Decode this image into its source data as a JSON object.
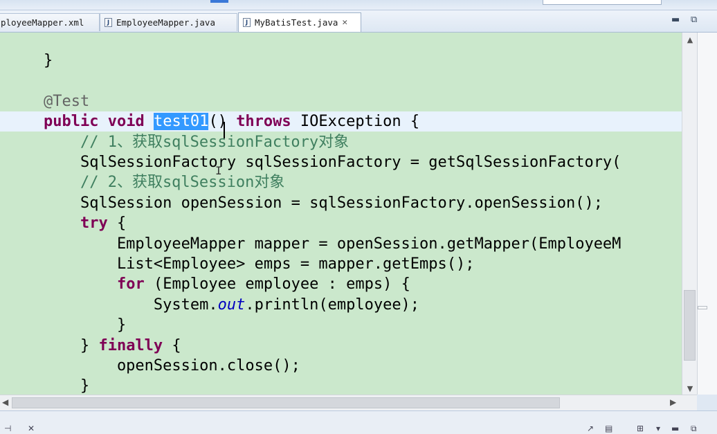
{
  "tabs": [
    {
      "label": "ployeeMapper.xml",
      "type": "xml",
      "active": false
    },
    {
      "label": "EmployeeMapper.java",
      "type": "java",
      "active": false
    },
    {
      "label": "MyBatisTest.java",
      "type": "java",
      "active": true
    }
  ],
  "tab_close_icon": "close-icon",
  "window_buttons": {
    "minimize": "minimize-icon",
    "maximize": "maximize-icon"
  },
  "code_lines": [
    [
      {
        "t": "    }",
        "c": ""
      }
    ],
    [
      {
        "t": "",
        "c": ""
      }
    ],
    [
      {
        "t": "    @Test",
        "c": "ann"
      }
    ],
    [
      {
        "t": "    ",
        "c": ""
      },
      {
        "t": "public",
        "c": "kw"
      },
      {
        "t": " ",
        "c": ""
      },
      {
        "t": "void",
        "c": "kw"
      },
      {
        "t": " ",
        "c": ""
      },
      {
        "t": "test01",
        "c": "sel"
      },
      {
        "t": "() ",
        "c": ""
      },
      {
        "t": "throws",
        "c": "kw"
      },
      {
        "t": " IOException {",
        "c": ""
      }
    ],
    [
      {
        "t": "        // 1、获取sqlSessionFactory对象",
        "c": "cmt"
      }
    ],
    [
      {
        "t": "        SqlSessionFactory sqlSessionFactory = getSqlSessionFactory(",
        "c": ""
      }
    ],
    [
      {
        "t": "        // 2、获取sqlSession对象",
        "c": "cmt"
      }
    ],
    [
      {
        "t": "        SqlSession openSession = sqlSessionFactory.openSession();",
        "c": ""
      }
    ],
    [
      {
        "t": "        ",
        "c": ""
      },
      {
        "t": "try",
        "c": "kw"
      },
      {
        "t": " {",
        "c": ""
      }
    ],
    [
      {
        "t": "            EmployeeMapper mapper = openSession.getMapper(EmployeeM",
        "c": ""
      }
    ],
    [
      {
        "t": "            List<Employee> emps = mapper.getEmps();",
        "c": ""
      }
    ],
    [
      {
        "t": "            ",
        "c": ""
      },
      {
        "t": "for",
        "c": "kw"
      },
      {
        "t": " (Employee employee : emps) {",
        "c": ""
      }
    ],
    [
      {
        "t": "                System.",
        "c": ""
      },
      {
        "t": "out",
        "c": "fld"
      },
      {
        "t": ".println(employee);",
        "c": ""
      }
    ],
    [
      {
        "t": "            }",
        "c": ""
      }
    ],
    [
      {
        "t": "        } ",
        "c": ""
      },
      {
        "t": "finally",
        "c": "kw"
      },
      {
        "t": " {",
        "c": ""
      }
    ],
    [
      {
        "t": "            openSession.close();",
        "c": ""
      }
    ],
    [
      {
        "t": "        }",
        "c": ""
      }
    ]
  ],
  "current_line_index": 3,
  "colors": {
    "editor_bg": "#cbe8cc",
    "keyword": "#7f0055",
    "comment": "#3f7f5f",
    "annotation": "#646464",
    "static_field": "#0000c0",
    "selection": "#3399ff",
    "current_line": "#e8f2fc"
  },
  "scroll_icons": {
    "up": "scroll-up-icon",
    "down": "scroll-down-icon",
    "left": "scroll-left-icon",
    "right": "scroll-right-icon"
  }
}
